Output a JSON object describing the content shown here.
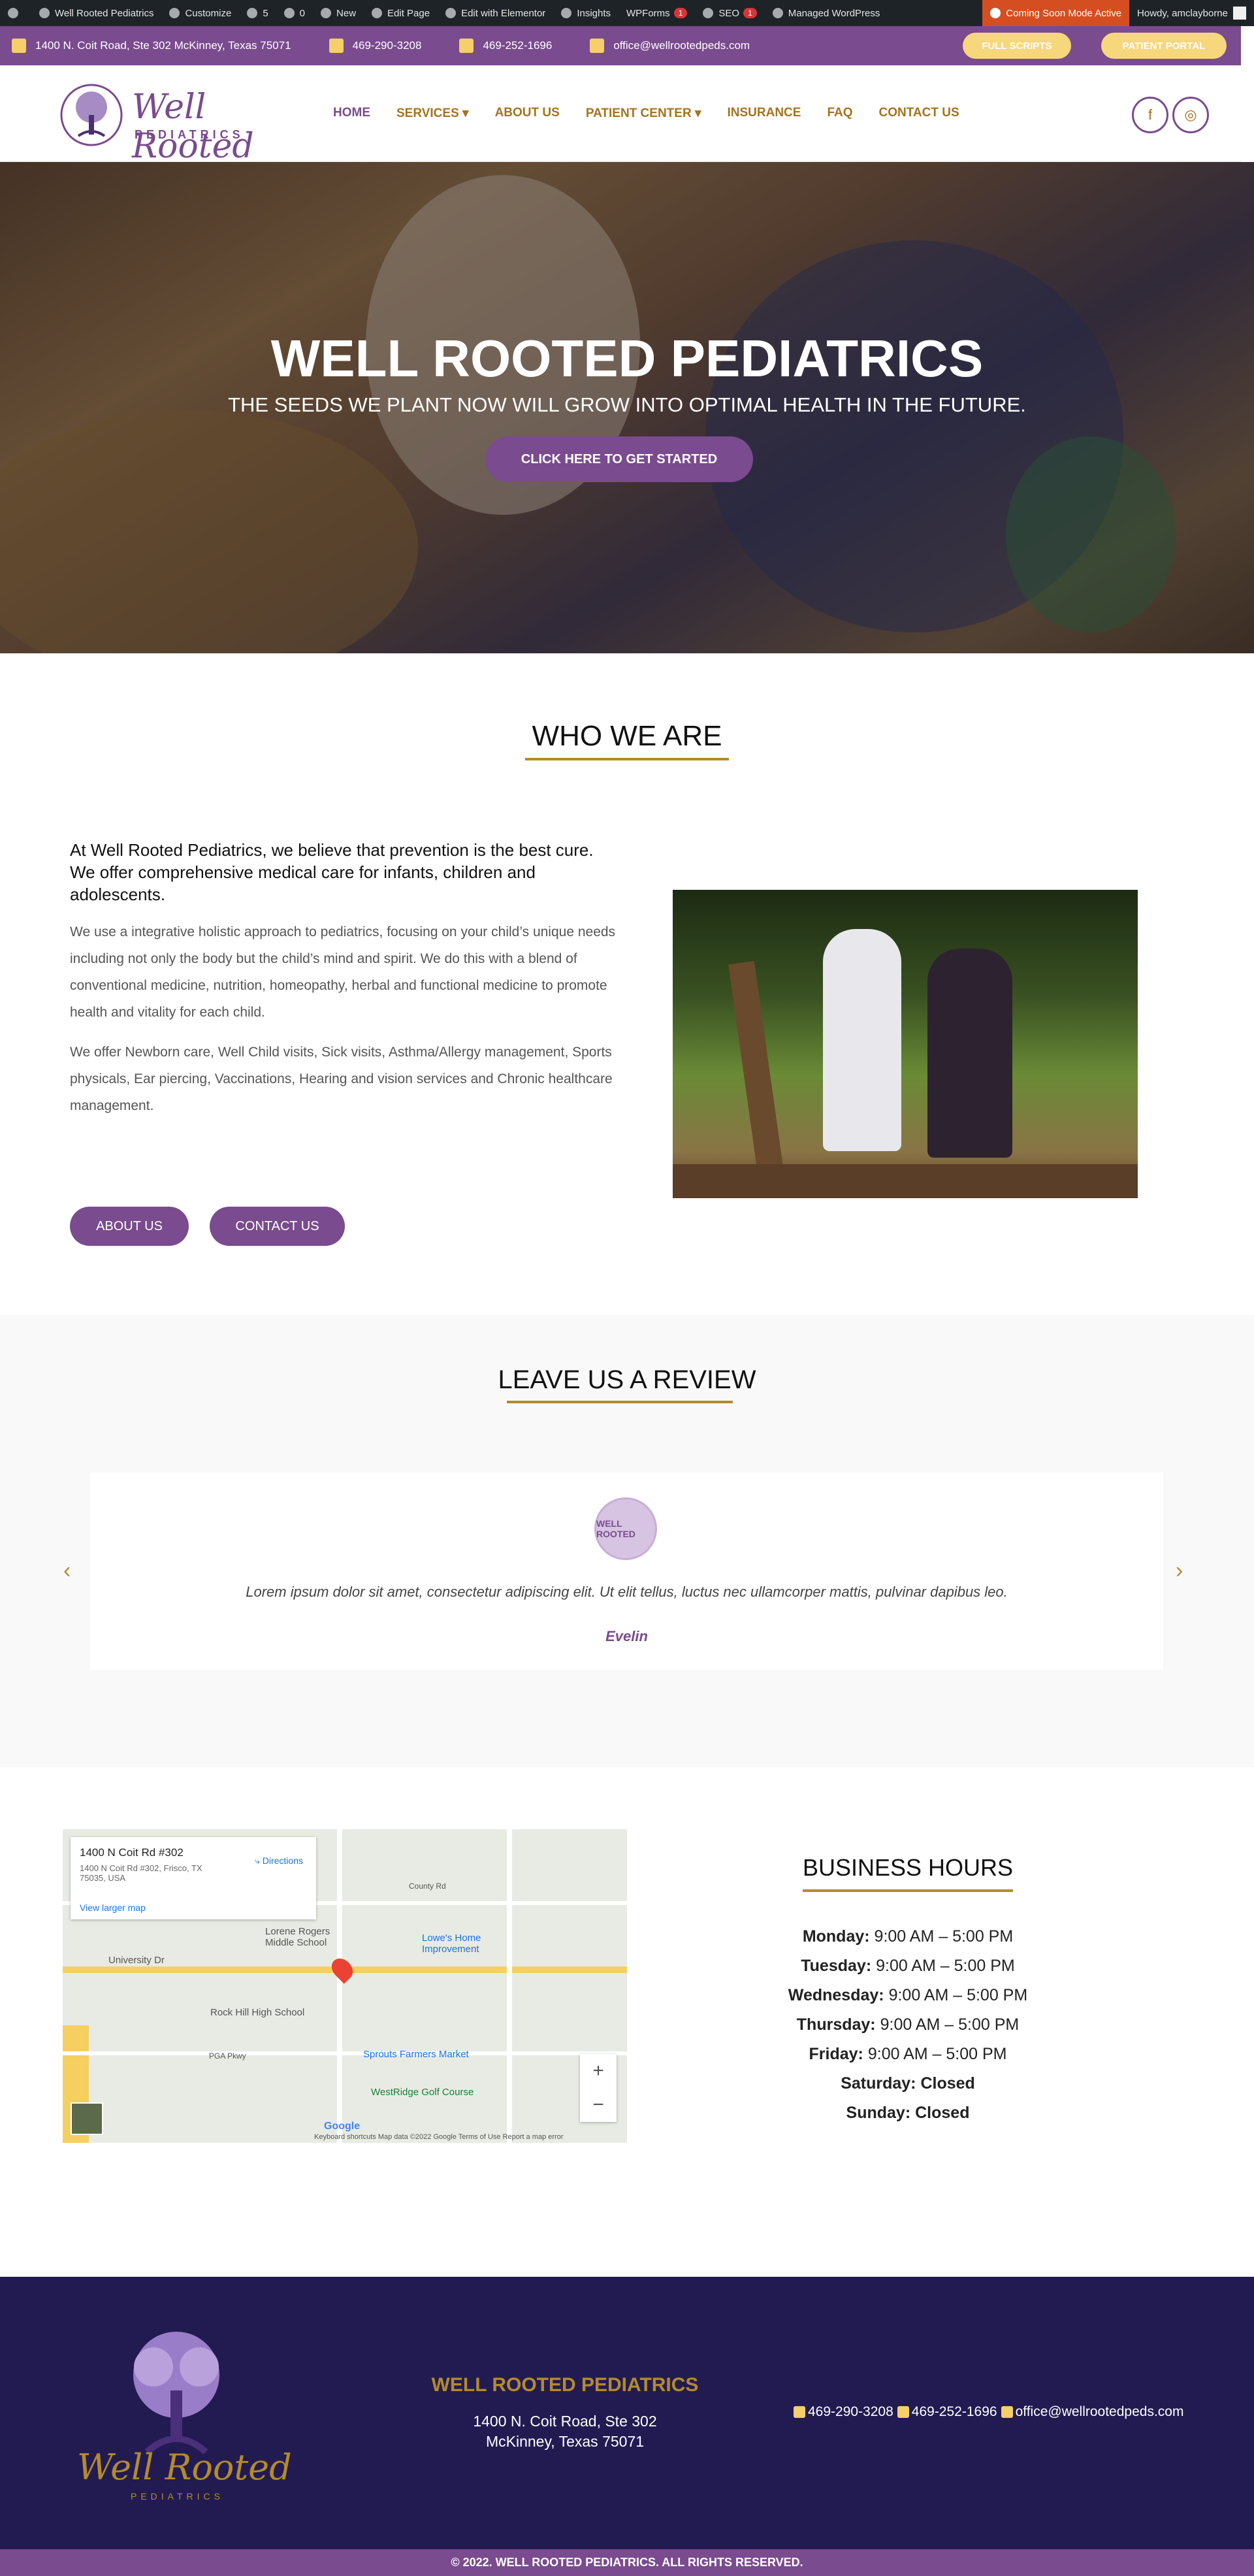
{
  "admin_bar": {
    "site_name": "Well Rooted Pediatrics",
    "customize": "Customize",
    "updates": "5",
    "comments": "0",
    "new": "New",
    "edit_page": "Edit Page",
    "edit_elementor": "Edit with Elementor",
    "insights": "Insights",
    "wpforms": "WPForms",
    "wpforms_badge": "1",
    "seo": "SEO",
    "seo_badge": "1",
    "managed_wp": "Managed WordPress",
    "coming_soon": "Coming Soon Mode Active",
    "howdy": "Howdy, amclayborne"
  },
  "top_bar": {
    "address": "1400 N. Coit Road, Ste 302 McKinney, Texas 75071",
    "phone": "469-290-3208",
    "fax": "469-252-1696",
    "email": "office@wellrootedpeds.com",
    "full_scripts": "FULL SCRIPTS",
    "patient_portal": "PATIENT PORTAL"
  },
  "logo": {
    "line1": "Well Rooted",
    "line2": "PEDIATRICS"
  },
  "nav": {
    "home": "HOME",
    "services": "SERVICES",
    "about": "ABOUT US",
    "patient_center": "PATIENT CENTER",
    "insurance": "INSURANCE",
    "faq": "FAQ",
    "contact": "CONTACT US"
  },
  "social": {
    "facebook": "f",
    "instagram": "◎"
  },
  "hero": {
    "title": "WELL ROOTED PEDIATRICS",
    "subtitle": "THE SEEDS WE PLANT NOW WILL GROW INTO OPTIMAL HEALTH IN THE FUTURE.",
    "cta": "CLICK HERE TO GET STARTED"
  },
  "who": {
    "title": "WHO WE ARE",
    "lead": "At Well Rooted Pediatrics, we believe that prevention is the best cure. We offer comprehensive medical care for infants, children and adolescents.",
    "p1": "We use a integrative holistic approach to pediatrics, focusing on your child’s unique needs including not only the body but the child’s mind and spirit. We do this with a blend of conventional medicine, nutrition, homeopathy, herbal and functional medicine to promote health and vitality for each child.",
    "p2": "We offer Newborn care, Well Child visits, Sick visits,  Asthma/Allergy management, Sports physicals, Ear piercing, Vaccinations, Hearing and vision services and Chronic healthcare management.",
    "about_btn": "ABOUT US",
    "contact_btn": "CONTACT US"
  },
  "review": {
    "title": "LEAVE US A REVIEW",
    "avatar_text": "WELL ROOTED",
    "quote": "Lorem ipsum dolor sit amet, consectetur adipiscing elit. Ut elit tellus, luctus nec ullamcorper mattis, pulvinar dapibus leo.",
    "author": "Evelin",
    "prev": "‹",
    "next": "›"
  },
  "map": {
    "place": "1400 N Coit Rd #302",
    "address": "1400 N Coit Rd #302, Frisco, TX 75035, USA",
    "directions": "Directions",
    "larger": "View larger map",
    "labels": [
      "Lorene Rogers Middle School",
      "Lowe's Home Improvement",
      "University Dr",
      "Rock Hill High School",
      "Sprouts Farmers Market",
      "WestRidge Golf Course",
      "PGA Pkwy",
      "County Rd"
    ],
    "zoom_in": "+",
    "zoom_out": "−",
    "google": "Google",
    "footer": "Keyboard shortcuts   Map data ©2022 Google   Terms of Use   Report a map error"
  },
  "hours": {
    "title": "BUSINESS HOURS",
    "rows": [
      {
        "day": "Monday:",
        "time": "9:00 AM – 5:00 PM"
      },
      {
        "day": "Tuesday:",
        "time": "9:00 AM – 5:00 PM"
      },
      {
        "day": "Wednesday:",
        "time": "9:00 AM – 5:00 PM"
      },
      {
        "day": "Thursday:",
        "time": "9:00 AM – 5:00 PM"
      },
      {
        "day": "Friday:",
        "time": "9:00 AM – 5:00 PM"
      },
      {
        "day": "Saturday:",
        "time": "Closed"
      },
      {
        "day": "Sunday:",
        "time": "Closed"
      }
    ]
  },
  "footer": {
    "brand": "Well Rooted",
    "brand_sub": "PEDIATRICS",
    "name": "WELL ROOTED PEDIATRICS",
    "addr1": "1400 N. Coit Road, Ste 302",
    "addr2": "McKinney, Texas 75071",
    "phone": "469-290-3208",
    "fax": "469-252-1696",
    "email": "office@wellrootedpeds.com",
    "copyright": "© 2022. WELL ROOTED PEDIATRICS. ALL RIGHTS RESERVED."
  },
  "colors": {
    "purple": "#7a4b8e",
    "gold": "#b38b2b",
    "navy": "#221b52",
    "yellow": "#f7d77b"
  }
}
